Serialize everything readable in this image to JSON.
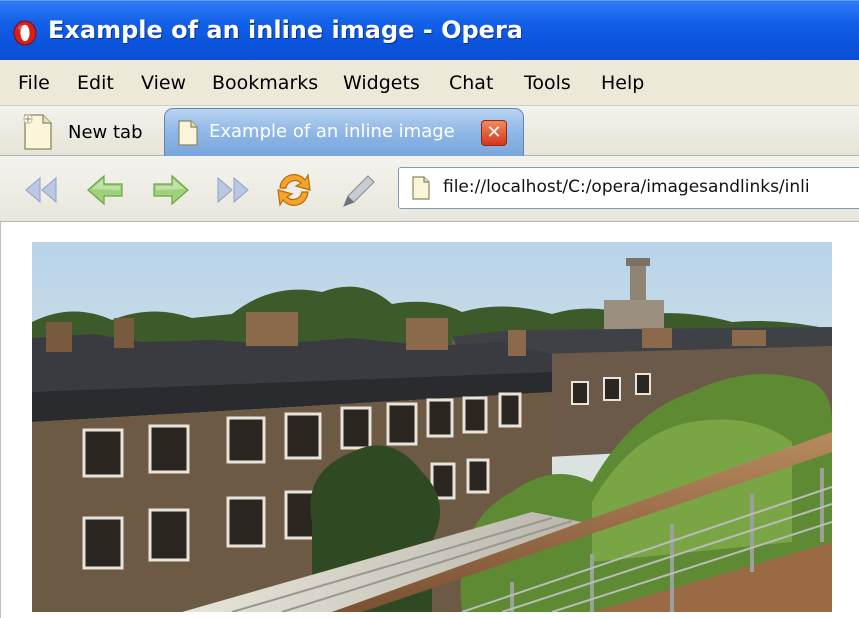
{
  "window": {
    "title": "Example of an inline image - Opera",
    "logo_icon": "opera-logo-icon"
  },
  "menu": {
    "items": [
      "File",
      "Edit",
      "View",
      "Bookmarks",
      "Widgets",
      "Chat",
      "Tools",
      "Help"
    ]
  },
  "tabs": [
    {
      "label": "New tab",
      "icon": "page-icon",
      "active": false
    },
    {
      "label": "Example of an inline image",
      "icon": "page-icon",
      "active": true,
      "close_icon": "close-icon"
    }
  ],
  "toolbar": {
    "buttons": [
      "rewind-icon",
      "back-icon",
      "forward-icon",
      "fast-forward-icon",
      "reload-icon",
      "edit-icon"
    ],
    "address": "file://localhost/C:/opera/imagesandlinks/inli"
  },
  "colors": {
    "titlebar": "#0b53dc",
    "menubar": "#ece9d8",
    "active_tab": "#8fb7e6",
    "nav_icons": "#86c25a",
    "reload_icon": "#f39a1e",
    "close_button": "#d5361b"
  },
  "content": {
    "image": "photo-of-terraced-houses-from-balcony"
  }
}
